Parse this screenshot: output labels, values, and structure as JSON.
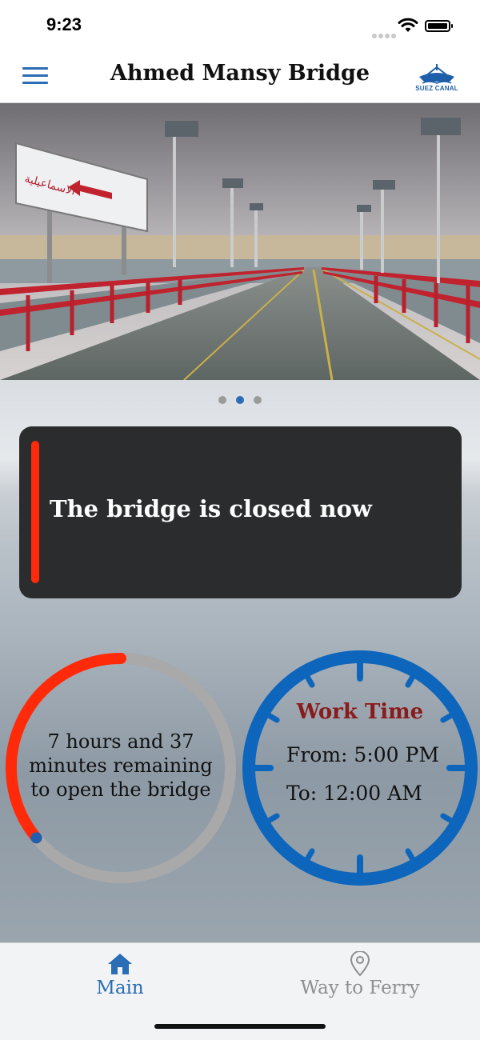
{
  "status_bar": {
    "time": "9:23"
  },
  "header": {
    "title": "Ahmed Mansy Bridge",
    "logo_text": "SUEZ CANAL"
  },
  "banner": {
    "sign_text": "الاسماعيلية",
    "dots_total": 3,
    "dot_active": 2
  },
  "status": {
    "message": "The bridge is closed now",
    "accent_color": "#ff2a0a"
  },
  "countdown": {
    "text": "7 hours and 37 minutes remaining to open the bridge",
    "elapsed_fraction": 0.36,
    "progress_color": "#ff2a0a",
    "track_color": "#a9a9a9"
  },
  "work_time": {
    "title": "Work Time",
    "from": "From: 5:00 PM",
    "to": "To: 12:00 AM",
    "ring_color": "#0d66bc"
  },
  "tabs": [
    {
      "label": "Main",
      "icon": "home-icon",
      "active": true
    },
    {
      "label": "Way to Ferry",
      "icon": "map-pin-icon",
      "active": false
    }
  ],
  "colors": {
    "accent_blue": "#2a6db5",
    "work_title": "#8a1b1b"
  }
}
